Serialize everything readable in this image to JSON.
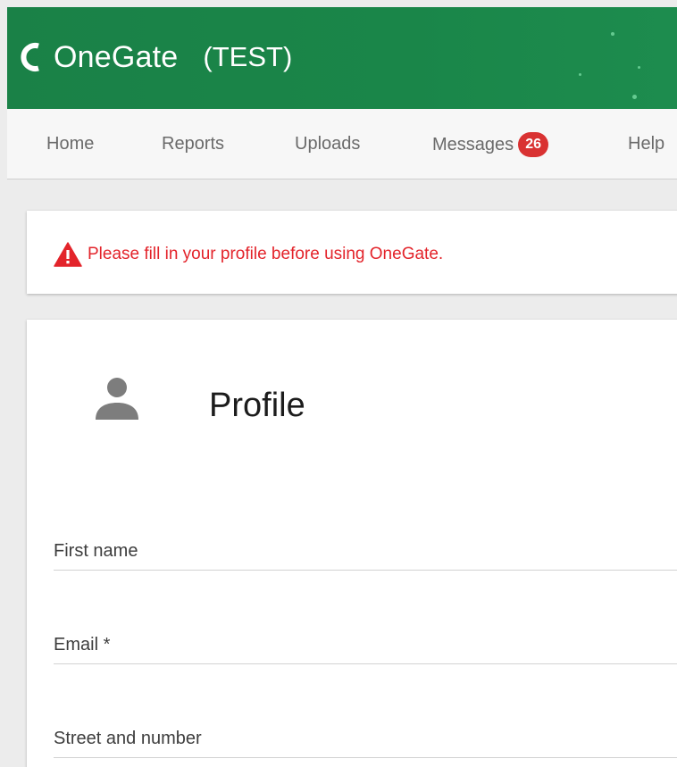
{
  "header": {
    "app_name": "OneGate",
    "environment": "(TEST)",
    "brand_color": "#1a8147"
  },
  "nav": {
    "items": [
      {
        "label": "Home"
      },
      {
        "label": "Reports"
      },
      {
        "label": "Uploads"
      },
      {
        "label": "Messages",
        "badge": "26"
      },
      {
        "label": "Help"
      }
    ]
  },
  "alert": {
    "icon": "warning-icon",
    "text": "Please fill in your profile before using OneGate.",
    "color": "#e3242b"
  },
  "profile": {
    "icon": "person-icon",
    "title": "Profile",
    "fields": [
      {
        "label": "First name",
        "value": ""
      },
      {
        "label": "Email *",
        "value": ""
      },
      {
        "label": "Street and number",
        "value": ""
      }
    ]
  }
}
